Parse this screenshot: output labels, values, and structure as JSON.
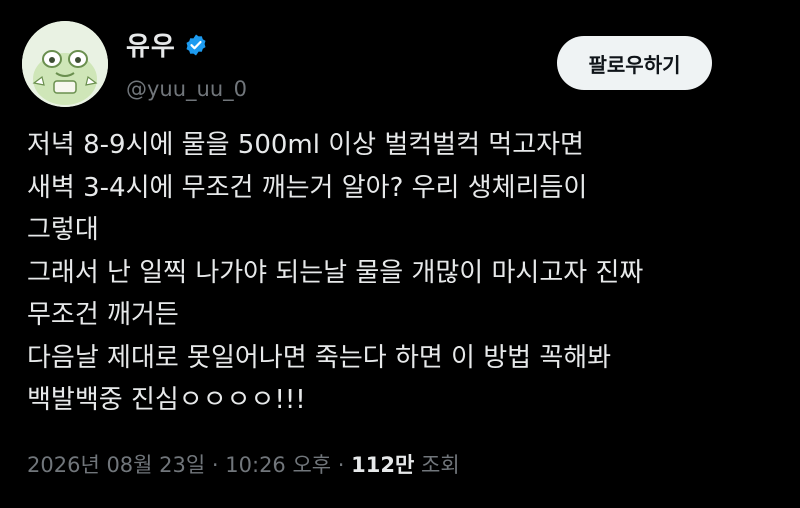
{
  "author": {
    "display_name": "유우",
    "handle": "@yuu_uu_0",
    "avatar_icon": "green-frog-character-avatar",
    "verified_icon": "verified-badge-icon",
    "verified_color": "#1d9bf0"
  },
  "follow_button": {
    "label": "팔로우하기"
  },
  "tweet": {
    "lines": [
      "저녁 8-9시에 물을 500ml 이상 벌컥벌컥 먹고자면",
      "새벽 3-4시에 무조건 깨는거 알아? 우리 생체리듬이",
      "그렇대",
      "그래서 난 일찍 나가야 되는날 물을 개많이 마시고자 진짜",
      "무조건 깨거든",
      "다음날 제대로 못일어나면 죽는다 하면 이 방법 꼭해봐",
      "백발백중 진심ㅇㅇㅇㅇ!!!"
    ]
  },
  "meta": {
    "date": "2026년 08월 23일",
    "separator": "·",
    "time": "10:26 오후",
    "views_count": "112만",
    "views_label": "조회"
  },
  "colors": {
    "background": "#000000",
    "text_primary": "#e7e9ea",
    "text_secondary": "#71767b",
    "follow_button_bg": "#eff3f4"
  }
}
